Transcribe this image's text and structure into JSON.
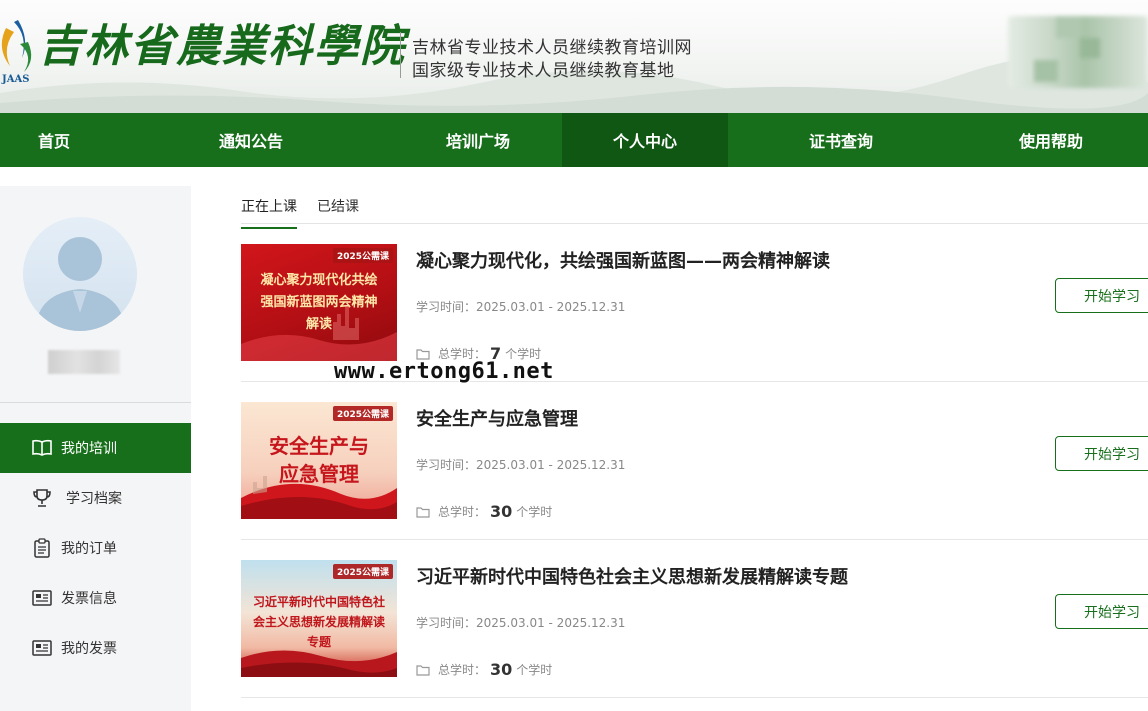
{
  "header": {
    "logo_abbr": "JAAS",
    "logo_title": "吉林省農業科學院",
    "subtitle_line1": "吉林省专业技术人员继续教育培训网",
    "subtitle_line2": "国家级专业技术人员继续教育基地"
  },
  "nav": {
    "items": [
      {
        "label": "首页",
        "active": false
      },
      {
        "label": "通知公告",
        "active": false
      },
      {
        "label": "培训广场",
        "active": false
      },
      {
        "label": "个人中心",
        "active": true
      },
      {
        "label": "证书查询",
        "active": false
      },
      {
        "label": "使用帮助",
        "active": false
      }
    ]
  },
  "sidebar": {
    "menu": [
      {
        "label": "我的培训",
        "icon": "book-icon",
        "active": true
      },
      {
        "label": "学习档案",
        "icon": "trophy-icon",
        "active": false
      },
      {
        "label": "我的订单",
        "icon": "clipboard-icon",
        "active": false
      },
      {
        "label": "发票信息",
        "icon": "invoice-icon",
        "active": false
      },
      {
        "label": "我的发票",
        "icon": "invoice-icon",
        "active": false
      }
    ]
  },
  "tabs": [
    {
      "label": "正在上课",
      "active": true
    },
    {
      "label": "已结课",
      "active": false
    }
  ],
  "courses": [
    {
      "badge": "2025公需课",
      "thumb_text": "凝心聚力现代化共绘强国新蓝图两会精神解读",
      "title": "凝心聚力现代化，共绘强国新蓝图——两会精神解读",
      "time_label": "学习时间：",
      "time_range": "2025.03.01 - 2025.12.31",
      "hours_label": "总学时：",
      "hours": "7",
      "hours_unit": "个学时",
      "button": "开始学习"
    },
    {
      "badge": "2025公需课",
      "thumb_text": "安全生产与应急管理",
      "title": "安全生产与应急管理",
      "time_label": "学习时间：",
      "time_range": "2025.03.01 - 2025.12.31",
      "hours_label": "总学时：",
      "hours": "30",
      "hours_unit": "个学时",
      "button": "开始学习"
    },
    {
      "badge": "2025公需课",
      "thumb_text": "习近平新时代中国特色社会主义思想新发展精解读专题",
      "title": "习近平新时代中国特色社会主义思想新发展精解读专题",
      "time_label": "学习时间：",
      "time_range": "2025.03.01 - 2025.12.31",
      "hours_label": "总学时：",
      "hours": "30",
      "hours_unit": "个学时",
      "button": "开始学习"
    }
  ],
  "watermark": "www.ertong61.net",
  "colors": {
    "brand_green": "#176f1b",
    "nav_active": "#0f5712",
    "sidebar_bg": "#f4f5f7"
  }
}
